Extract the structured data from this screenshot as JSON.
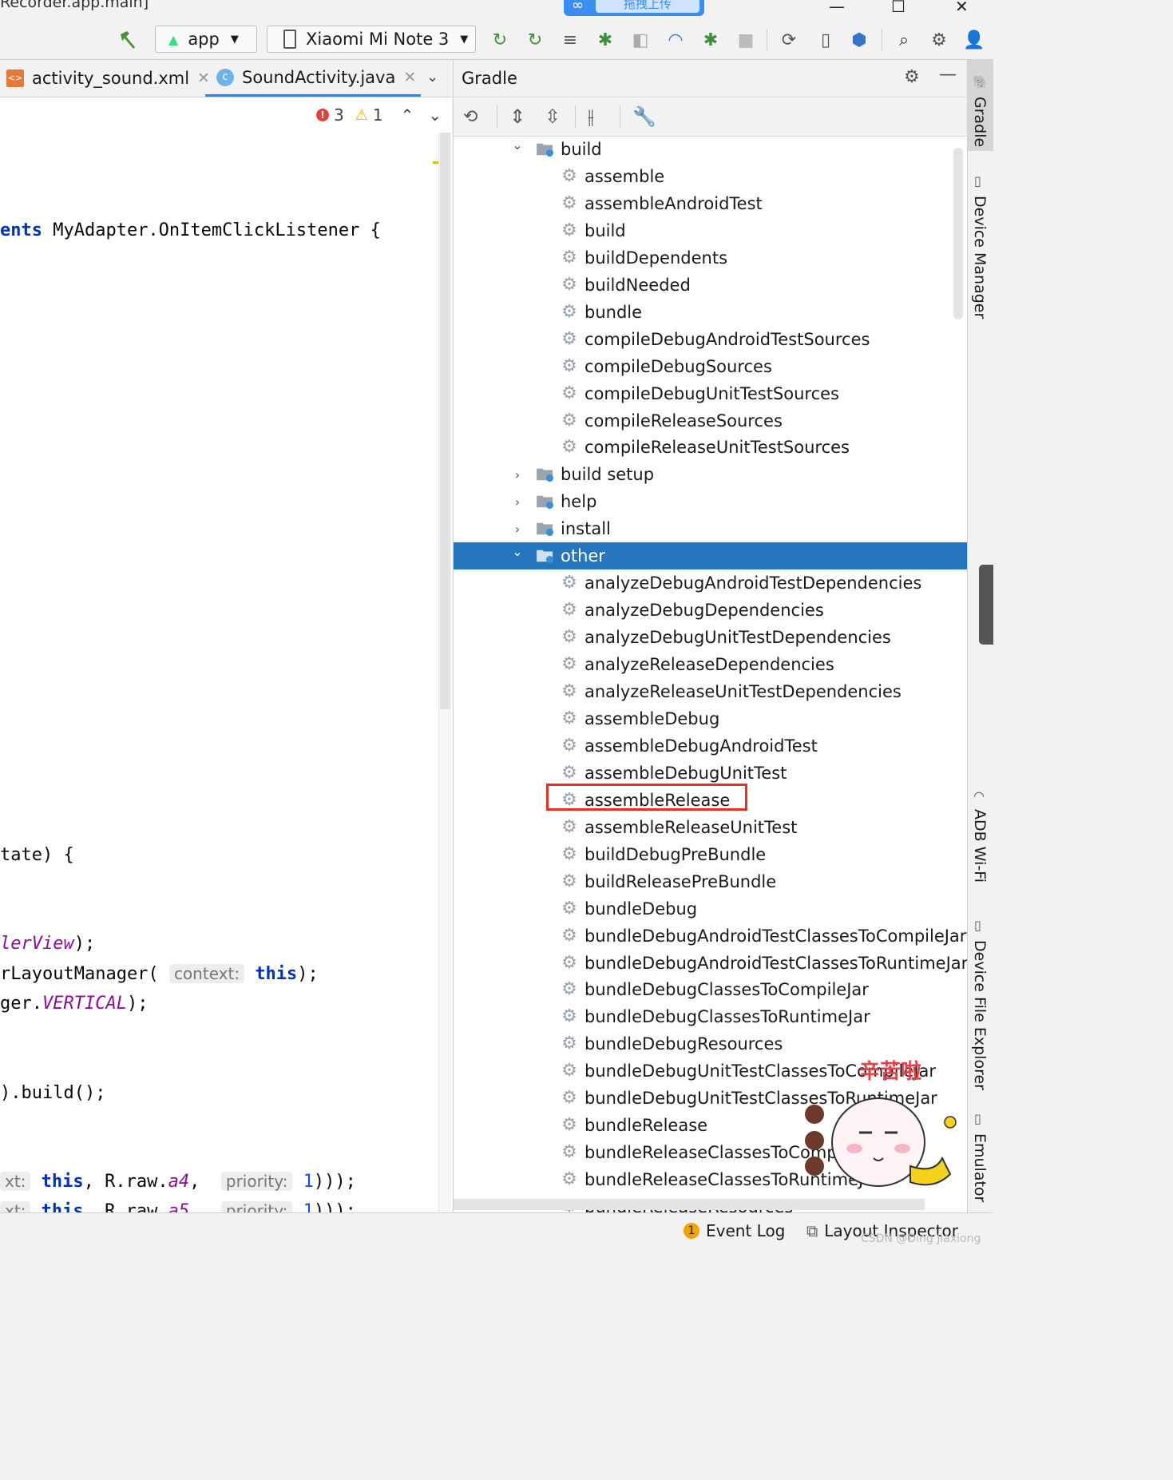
{
  "window": {
    "title": "Recorder.app.main]"
  },
  "upload": {
    "label": "拖拽上传"
  },
  "toolbar": {
    "run_config": "app",
    "device": "Xiaomi Mi Note 3"
  },
  "tabs": [
    {
      "label": "activity_sound.xml",
      "active": false
    },
    {
      "label": "SoundActivity.java",
      "active": true
    }
  ],
  "inspections": {
    "errors": "3",
    "warnings": "1"
  },
  "code": {
    "line1_kw": "ents",
    "line1_rest": " MyAdapter.OnItemClickListener {",
    "line2": "tate) {",
    "line3_it": "lerView",
    "line3_rest": ");",
    "line4_a": "rLayoutManager(",
    "line4_hint": "context:",
    "line4_kw": "this",
    "line4_rest": ");",
    "line5_a": "ger.",
    "line5_it": "VERTICAL",
    "line5_rest": ");",
    "line6": ").build();",
    "line7_hint1": "xt:",
    "line7_kw": "this",
    "line7_mid": ", R.raw.",
    "line7_it": "a4",
    "line7_sep": ",",
    "line7_hint2": "priority:",
    "line7_num": "1",
    "line7_end": ")));",
    "line8_hint1": "xt:",
    "line8_kw": "this",
    "line8_mid": ", R.raw.",
    "line8_it": "a5",
    "line8_sep": ",",
    "line8_hint2": "priority:",
    "line8_num": "1",
    "line8_end": ")));"
  },
  "gradle": {
    "title": "Gradle",
    "tree": {
      "build": {
        "label": "build",
        "tasks": [
          "assemble",
          "assembleAndroidTest",
          "build",
          "buildDependents",
          "buildNeeded",
          "bundle",
          "compileDebugAndroidTestSources",
          "compileDebugSources",
          "compileDebugUnitTestSources",
          "compileReleaseSources",
          "compileReleaseUnitTestSources"
        ]
      },
      "build_setup": "build setup",
      "help": "help",
      "install": "install",
      "other": {
        "label": "other",
        "tasks": [
          "analyzeDebugAndroidTestDependencies",
          "analyzeDebugDependencies",
          "analyzeDebugUnitTestDependencies",
          "analyzeReleaseDependencies",
          "analyzeReleaseUnitTestDependencies",
          "assembleDebug",
          "assembleDebugAndroidTest",
          "assembleDebugUnitTest",
          "assembleRelease",
          "assembleReleaseUnitTest",
          "buildDebugPreBundle",
          "buildReleasePreBundle",
          "bundleDebug",
          "bundleDebugAndroidTestClassesToCompileJar",
          "bundleDebugAndroidTestClassesToRuntimeJar",
          "bundleDebugClassesToCompileJar",
          "bundleDebugClassesToRuntimeJar",
          "bundleDebugResources",
          "bundleDebugUnitTestClassesToCompileJar",
          "bundleDebugUnitTestClassesToRuntimeJar",
          "bundleRelease",
          "bundleReleaseClassesToCompileJar",
          "bundleReleaseClassesToRuntimeJar",
          "bundleReleaseResources"
        ]
      },
      "highlighted_task": "assembleRelease"
    }
  },
  "side_tabs": [
    "Gradle",
    "Device Manager",
    "ADB Wi-Fi",
    "Device File Explorer",
    "Emulator"
  ],
  "status": {
    "event_log_count": "1",
    "event_log": "Event Log",
    "layout_inspector": "Layout Inspector",
    "watermark": "CSDN @Ding Jiaxiong"
  },
  "colors": {
    "selection": "#2675bf",
    "highlight_box": "#e4302b",
    "accent": "#4083c9"
  }
}
